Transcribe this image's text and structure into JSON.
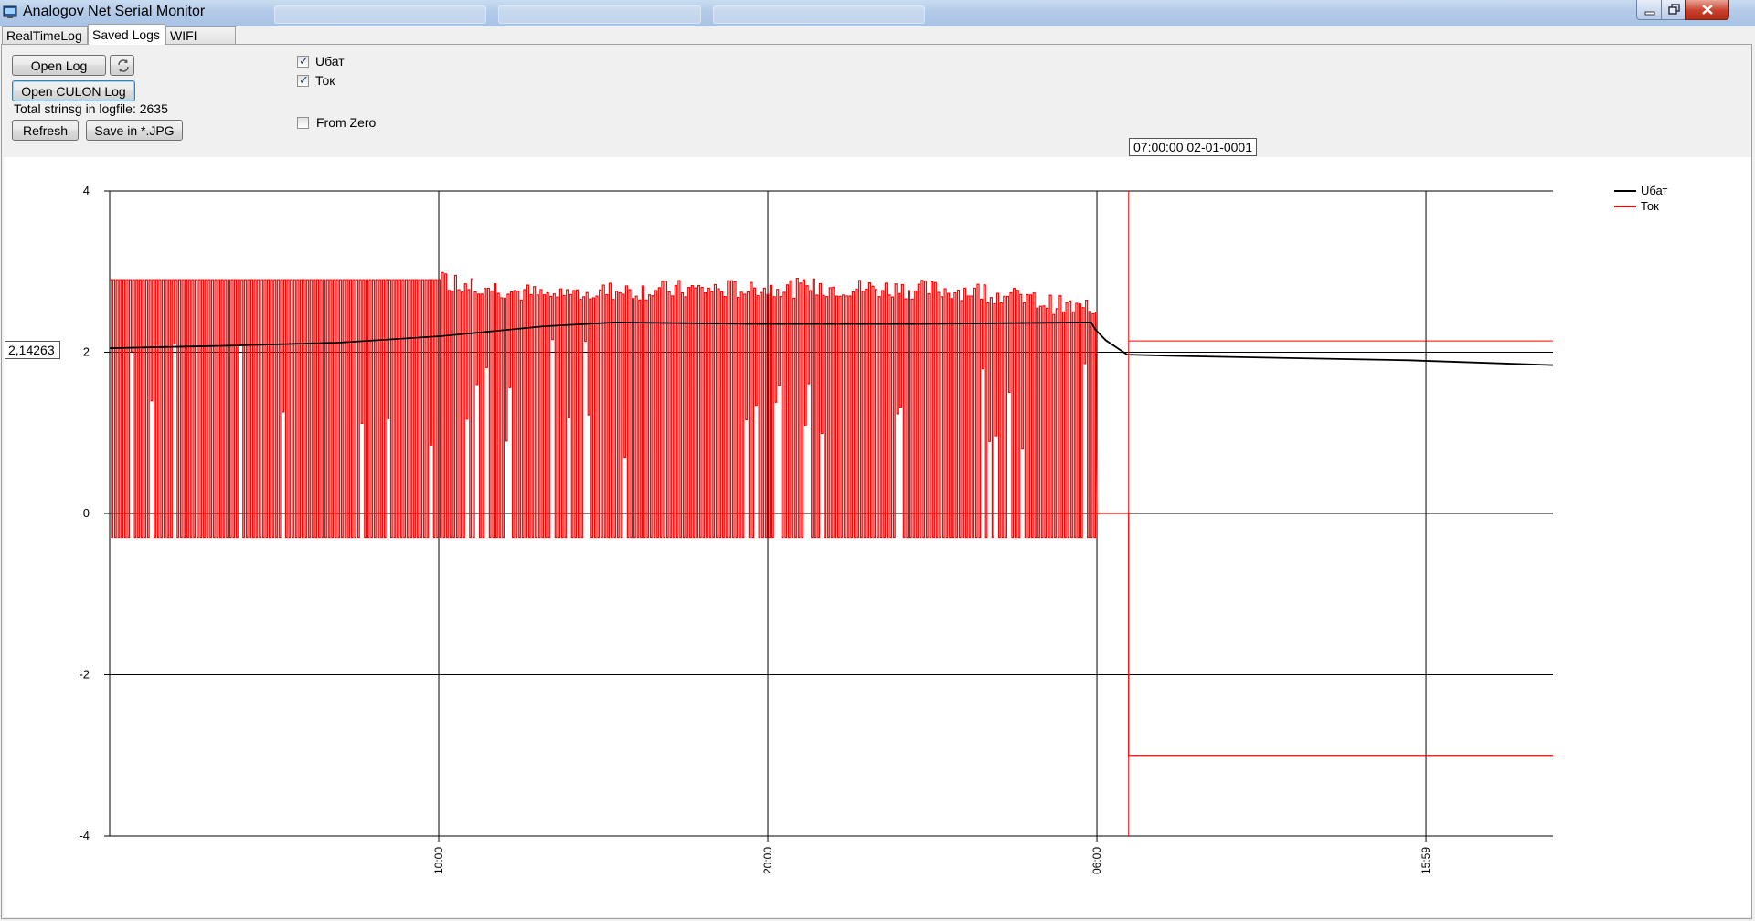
{
  "window": {
    "title": "Analogov Net Serial Monitor",
    "icon": "app-icon"
  },
  "tabs": [
    {
      "label": "RealTimeLog",
      "active": false
    },
    {
      "label": "Saved Logs",
      "active": true
    },
    {
      "label": "WIFI logers",
      "active": false
    }
  ],
  "controls": {
    "open_log": "Open Log",
    "reload_icon": "refresh-arrows-icon",
    "open_culon_log": "Open CULON Log",
    "total_strings": "Total strinsg in logfile: 2635",
    "refresh": "Refresh",
    "save_jpg": "Save in *.JPG",
    "checkboxes": [
      {
        "label": "Uбат",
        "checked": true
      },
      {
        "label": "Ток",
        "checked": true
      },
      {
        "label": "From Zero",
        "checked": false
      }
    ]
  },
  "cursor": {
    "time_label": "07:00:00 02-01-0001",
    "value_label": "2,14263"
  },
  "chart_data": {
    "type": "line",
    "ylim": [
      -4,
      4
    ],
    "y_ticks": [
      "4",
      "2",
      "0",
      "-2",
      "-4"
    ],
    "x_ticks": [
      "10:00",
      "20:00",
      "06:00",
      "15:59"
    ],
    "grid": true,
    "legend_position": "top-right",
    "cursor_value": 2.14263,
    "series": [
      {
        "name": "Uбат",
        "color": "#000000",
        "points": [
          [
            0,
            2.05
          ],
          [
            0.08,
            2.08
          ],
          [
            0.16,
            2.12
          ],
          [
            0.23,
            2.2
          ],
          [
            0.3,
            2.32
          ],
          [
            0.35,
            2.37
          ],
          [
            0.45,
            2.35
          ],
          [
            0.56,
            2.35
          ],
          [
            0.68,
            2.37
          ],
          [
            0.683,
            2.28
          ],
          [
            0.69,
            2.15
          ],
          [
            0.705,
            1.97
          ],
          [
            0.75,
            1.95
          ],
          [
            0.9,
            1.9
          ],
          [
            1.0,
            1.84
          ]
        ]
      },
      {
        "name": "Ток",
        "color": "#ff0000",
        "description_points": [
          [
            0,
            2.9
          ],
          [
            0.228,
            2.9
          ],
          [
            0.3,
            2.7
          ],
          [
            0.35,
            2.76
          ],
          [
            0.5,
            2.8
          ],
          [
            0.6,
            2.76
          ],
          [
            0.683,
            2.5
          ],
          [
            0.684,
            0
          ],
          [
            0.705,
            0
          ],
          [
            0.706,
            -3.0
          ],
          [
            1.0,
            -3.0
          ]
        ],
        "pulse_low": -0.3,
        "pulse_range": [
          0,
          0.683
        ]
      }
    ],
    "x_marker": 0.706,
    "marker_value": 2.14
  },
  "colors": {
    "series_voltage": "#000000",
    "series_current": "#ff0000",
    "titlebar": "#b9cfe9"
  }
}
